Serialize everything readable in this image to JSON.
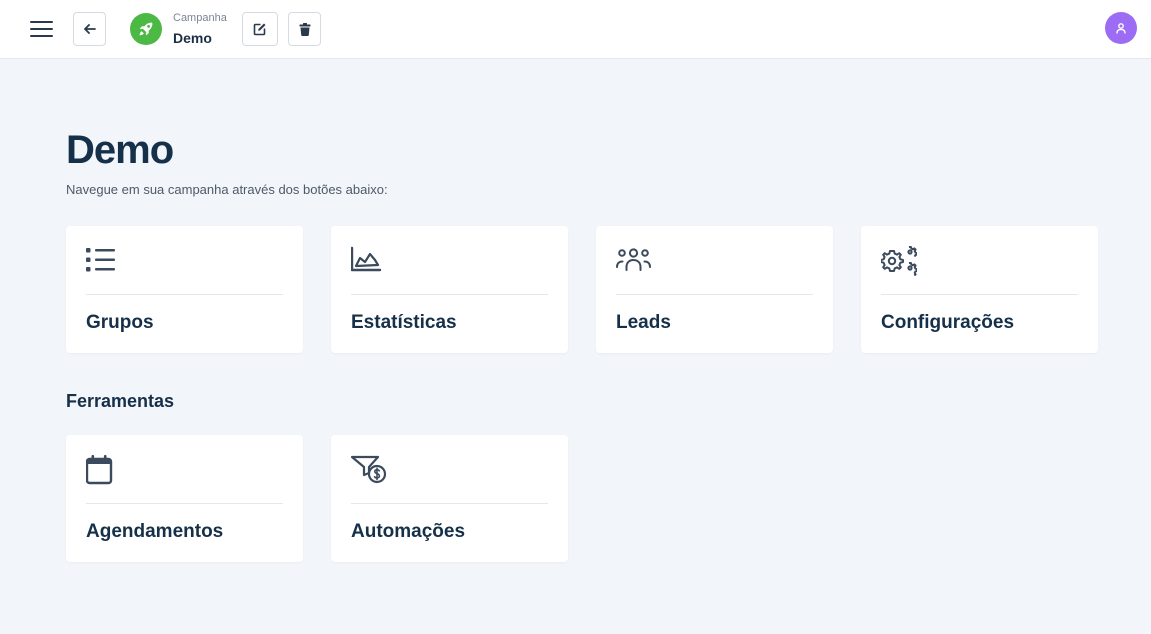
{
  "header": {
    "campaign_kicker": "Campanha",
    "campaign_name": "Demo",
    "icons": {
      "menu": "hamburger-menu-icon",
      "back": "arrow-left-icon",
      "logo": "rocket-icon",
      "edit": "edit-icon",
      "delete": "trash-icon",
      "avatar": "user-icon"
    },
    "colors": {
      "logo_bg": "#4cb944",
      "avatar_bg": "#9c6cf5"
    }
  },
  "main": {
    "title": "Demo",
    "subtitle": "Navegue em sua campanha através dos botões abaixo:",
    "cards": [
      {
        "label": "Grupos",
        "icon": "list-icon"
      },
      {
        "label": "Estatísticas",
        "icon": "area-chart-icon"
      },
      {
        "label": "Leads",
        "icon": "users-icon"
      },
      {
        "label": "Configurações",
        "icon": "gears-icon"
      }
    ],
    "tools_title": "Ferramentas",
    "tools": [
      {
        "label": "Agendamentos",
        "icon": "calendar-icon"
      },
      {
        "label": "Automações",
        "icon": "funnel-dollar-icon"
      }
    ]
  }
}
